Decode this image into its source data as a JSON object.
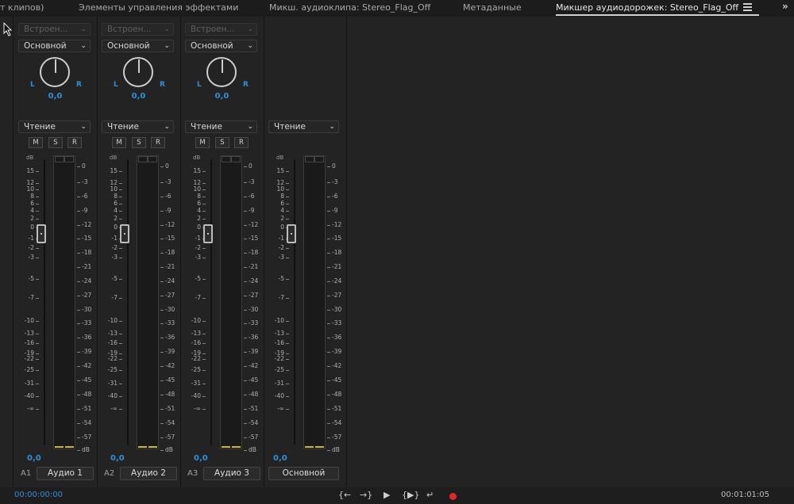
{
  "tabs": [
    {
      "label": "т клипов)"
    },
    {
      "label": "Элементы управления эффектами"
    },
    {
      "label": "Микш. аудиоклипа: Stereo_Flag_Off"
    },
    {
      "label": "Метаданные"
    },
    {
      "label": "Микшер аудиодорожек: Stereo_Flag_Off",
      "active": true
    }
  ],
  "tab_icons": {
    "menu": "hamburger-menu-icon",
    "more": "double-chevron-right-icon"
  },
  "mixer": {
    "tracks": [
      {
        "effect_slot": "Встроен...",
        "routing": "Основной",
        "pan_L": "L",
        "pan_R": "R",
        "pan_value": "0,0",
        "automation": "Чтение",
        "mute": "M",
        "solo": "S",
        "record": "R",
        "volume": "0,0",
        "track_id": "A1",
        "name": "Аудио 1"
      },
      {
        "effect_slot": "Встроен...",
        "routing": "Основной",
        "pan_L": "L",
        "pan_R": "R",
        "pan_value": "0,0",
        "automation": "Чтение",
        "mute": "M",
        "solo": "S",
        "record": "R",
        "volume": "0,0",
        "track_id": "A2",
        "name": "Аудио 2"
      },
      {
        "effect_slot": "Встроен...",
        "routing": "Основной",
        "pan_L": "L",
        "pan_R": "R",
        "pan_value": "0,0",
        "automation": "Чтение",
        "mute": "M",
        "solo": "S",
        "record": "R",
        "volume": "0,0",
        "track_id": "A3",
        "name": "Аудио 3"
      }
    ],
    "master": {
      "automation": "Чтение",
      "volume": "0,0",
      "name": "Основной"
    },
    "db_label": "dB",
    "fader_scale": [
      "15",
      "12",
      "10",
      "8",
      "6",
      "4",
      "2",
      "0",
      "-1",
      "-2",
      "-3",
      "-5",
      "-7",
      "-10",
      "-13",
      "-16",
      "-19",
      "-22",
      "-25",
      "-31",
      "-40",
      "-∞"
    ],
    "meter_scale": [
      "0",
      "-3",
      "-6",
      "-9",
      "-12",
      "-15",
      "-18",
      "-21",
      "-24",
      "-27",
      "-30",
      "-33",
      "-36",
      "-39",
      "-42",
      "-45",
      "-48",
      "-51",
      "-54",
      "-57",
      "dB"
    ]
  },
  "transport": {
    "current_timecode": "00:00:00:00",
    "duration_timecode": "00:01:01:05",
    "buttons": {
      "go_in": "{←",
      "go_out": "→}",
      "play": "▶",
      "play_in_out": "{▶}",
      "loop": "↵"
    },
    "colors": {
      "record": "#e02828",
      "timecode": "#2f8fd6"
    }
  },
  "colors": {
    "accent": "#2f8fd6",
    "meter_level": "#c8b92c",
    "background": "#232323"
  }
}
